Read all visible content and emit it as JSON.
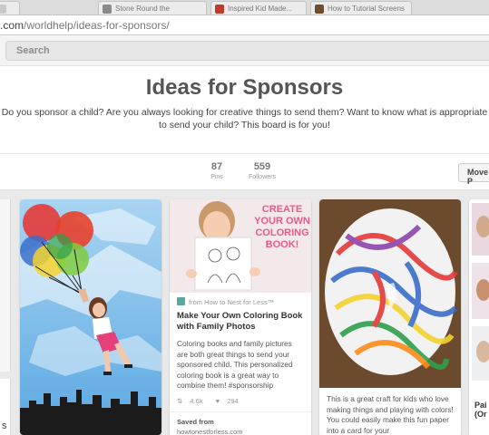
{
  "browser": {
    "tabs": [
      {
        "label": "",
        "favicon_color": "#c9c9c9"
      },
      {
        "label": "Stone Round the",
        "favicon_color": "#8a8a8a"
      },
      {
        "label": "Inspired Kid Made...",
        "favicon_color": "#c0392b"
      },
      {
        "label": "How to Tutorial Screens",
        "favicon_color": "#6d4c2f"
      }
    ],
    "url_prefix": ".com",
    "url_path": "/worldhelp/ideas-for-sponsors/"
  },
  "header": {
    "search_placeholder": "Search"
  },
  "board": {
    "title": "Ideas for Sponsors",
    "description_line1": "Do you sponsor a child? Are you always looking for creative things to send them? Want to know what is appropriate",
    "description_line2": "to send your child? This board is for you!",
    "pins_count": "87",
    "pins_label": "Pins",
    "followers_count": "559",
    "followers_label": "Followers",
    "move_label": "Move P"
  },
  "pins": {
    "col2": {
      "image_text": [
        "CREATE",
        "YOUR OWN",
        "COLORING",
        "BOOK!"
      ],
      "from": "from How to Nest for Less™",
      "title": "Make Your Own Coloring Book with Family Photos",
      "description": "Coloring books and family pictures are both great things to send your sponsored child. This personalized coloring book is a great way to combine them! #sponsorship",
      "repins": "4.6k",
      "likes": "294",
      "saved_label": "Saved from",
      "saved_source": "howtonestforless.com"
    },
    "col3": {
      "description": "This is a great craft for kids who love making things and playing with colors! You could easily make this fun paper into a card for your"
    },
    "col4": {
      "text_peek": "Pai (Or"
    },
    "left_peek_char": "s"
  },
  "colors": {
    "accent_title": "#555555",
    "background": "#e9e9e9",
    "card": "#ffffff",
    "sky_blue": "#70b7e8",
    "pink_text": "#ec5a8a"
  }
}
